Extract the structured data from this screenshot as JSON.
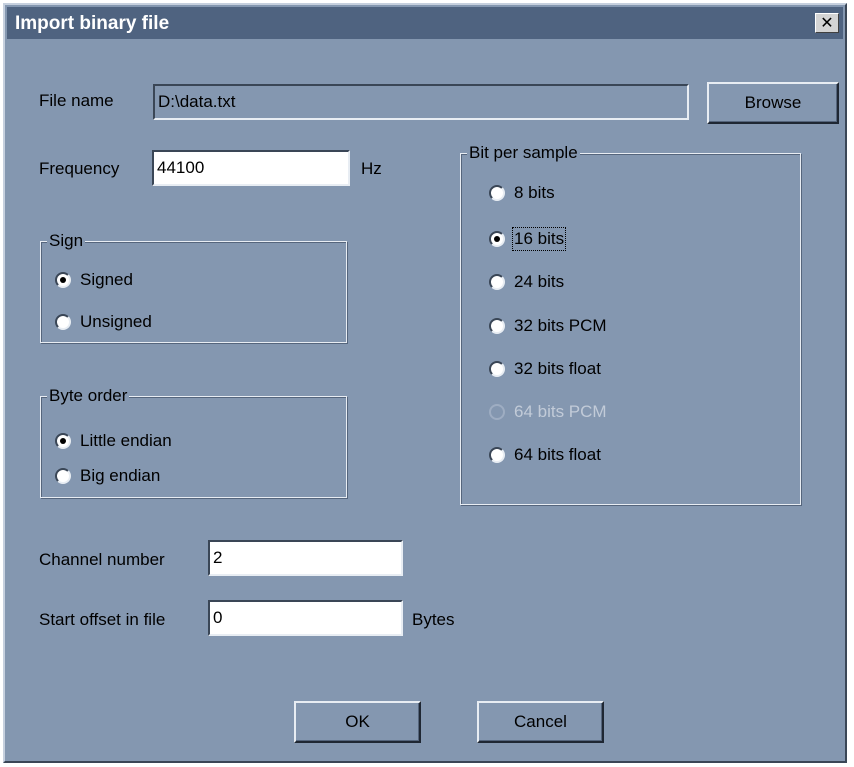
{
  "window": {
    "title": "Import binary file",
    "close_label": "✕"
  },
  "file": {
    "label": "File name",
    "value": "D:\\data.txt",
    "browse_label": "Browse"
  },
  "frequency": {
    "label": "Frequency",
    "value": "44100",
    "unit": "Hz"
  },
  "sign": {
    "legend": "Sign",
    "options": [
      {
        "label": "Signed",
        "selected": true
      },
      {
        "label": "Unsigned",
        "selected": false
      }
    ]
  },
  "byte_order": {
    "legend": "Byte order",
    "options": [
      {
        "label": "Little endian",
        "selected": true
      },
      {
        "label": "Big endian",
        "selected": false
      }
    ]
  },
  "bits": {
    "legend": "Bit per sample",
    "options": [
      {
        "label": "8 bits",
        "selected": false,
        "enabled": true
      },
      {
        "label": "16 bits",
        "selected": true,
        "enabled": true
      },
      {
        "label": "24 bits",
        "selected": false,
        "enabled": true
      },
      {
        "label": "32 bits PCM",
        "selected": false,
        "enabled": true
      },
      {
        "label": "32 bits float",
        "selected": false,
        "enabled": true
      },
      {
        "label": "64 bits PCM",
        "selected": false,
        "enabled": false
      },
      {
        "label": "64 bits float",
        "selected": false,
        "enabled": true
      }
    ]
  },
  "channels": {
    "label": "Channel number",
    "value": "2"
  },
  "offset": {
    "label": "Start offset in file",
    "value": "0",
    "unit": "Bytes"
  },
  "buttons": {
    "ok": "OK",
    "cancel": "Cancel"
  }
}
